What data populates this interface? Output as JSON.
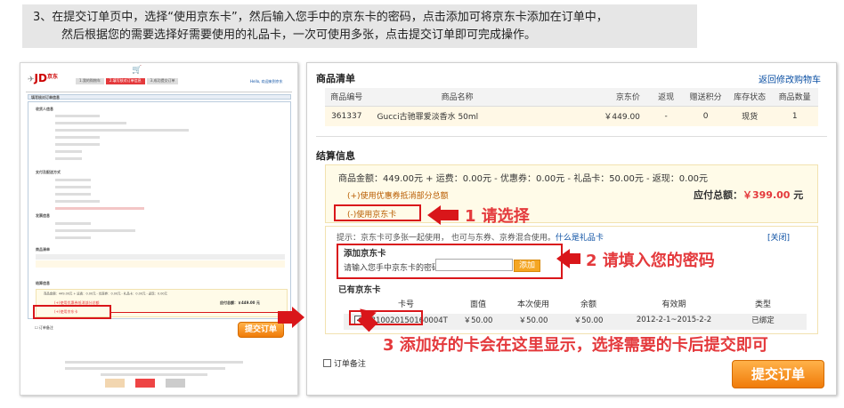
{
  "banner": {
    "line1": "3、在提交订单页中，选择“使用京东卡”，然后输入您手中的京东卡的密码，点击添加可将京东卡添加在订单中，",
    "line2": "然后根据您的需要选择好需要使用的礼品卡，一次可使用多张，点击提交订单即可完成操作。"
  },
  "thumb": {
    "logo": "JD",
    "logo_cn": "京东",
    "logo_com": ".COM",
    "steps": [
      "1.我的购物车",
      "2.填写核对订单信息",
      "3.成功提交订单"
    ],
    "login_hint": "Hello, 欢迎来到京东",
    "page_title": "填写核对订单信息",
    "receiver_title": "收货人信息",
    "payment_title": "支付及配送方式",
    "invoice_title": "发票信息",
    "goods_title": "商品清单",
    "settle_title": "结算信息",
    "settle_line": "商品金额：449.00元 + 运费：0.00元 - 优惠券：0.00元 - 礼品卡：0.00元 - 返现：0.00元",
    "due": "应付总额：￥449.00 元",
    "opt1": "(+)使用优惠券抵消部分总额",
    "opt2": "(+)使用京东卡",
    "remark": "订单备注",
    "submit": "提交订单"
  },
  "goods": {
    "title": "商品清单",
    "back_link": "返回修改购物车",
    "headers": [
      "商品编号",
      "商品名称",
      "京东价",
      "返现",
      "赠送积分",
      "库存状态",
      "商品数量"
    ],
    "row": [
      "361337",
      "Gucci古驰罪爱淡香水 50ml",
      "￥449.00",
      "-",
      "0",
      "现货",
      "1"
    ]
  },
  "settle": {
    "title": "结算信息",
    "summary": "商品金额：449.00元 + 运费：0.00元 - 优惠券：0.00元 - 礼品卡：50.00元 - 返现：0.00元",
    "coupon_toggle": "(+)使用优惠券抵消部分总额",
    "due_label": "应付总额：",
    "due_value": "￥399.00",
    "due_unit": "元",
    "jdcard_toggle": "(-)使用京东卡",
    "tip": "提示：京东卡可多张一起使用，     也可与东券、京券混合使用。",
    "tip_link": "什么是礼品卡",
    "close": "[关闭]",
    "add_title": "添加京东卡",
    "pwd_label": "请输入您手中京东卡的密码：",
    "pwd_value": "",
    "add_button": "添加",
    "have_title": "已有京东卡",
    "card_headers": [
      "卡号",
      "面值",
      "本次使用",
      "余额",
      "有效期",
      "类型"
    ],
    "card_row": [
      "1810020150160004T",
      "￥50.00",
      "￥50.00",
      "￥50.00",
      "2012-2-1~2015-2-2",
      "已绑定"
    ],
    "remark": "订单备注",
    "submit": "提交订单"
  },
  "annotations": {
    "s1": "1 请选择",
    "s2": "2 请填入您的密码",
    "s3": "3 添加好的卡会在这里显示，选择需要的卡后提交即可"
  },
  "colors": {
    "accent": "#e4393c",
    "link": "#0a4fa3",
    "submit": "#f07b09"
  }
}
